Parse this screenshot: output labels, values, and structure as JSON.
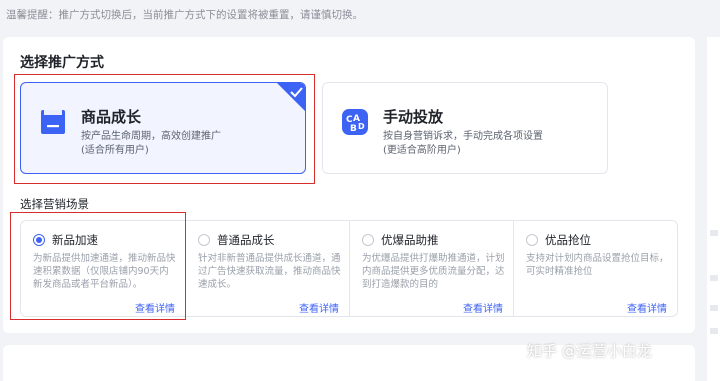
{
  "tip": "温馨提醒：推广方式切换后，当前推广方式下的设置将被重置，请谨慎切换。",
  "promo_section": {
    "title": "选择推广方式",
    "modes": [
      {
        "name": "商品成长",
        "desc_line1": "按产品生命周期，高效创建推广",
        "desc_line2": "(适合所有用户)",
        "selected": true,
        "icon": "product-bag-icon"
      },
      {
        "name": "手动投放",
        "desc_line1": "按自身营销诉求，手动完成各项设置",
        "desc_line2": "(更适合高阶用户)",
        "selected": false,
        "icon": "manual-cards-icon"
      }
    ]
  },
  "scene_section": {
    "title": "选择营销场景",
    "detail_label": "查看详情",
    "scenes": [
      {
        "name": "新品加速",
        "desc": "为新品提供加速通道，推动新品快速积累数据（仅限店铺内90天内新发商品或者平台新品）。",
        "checked": true
      },
      {
        "name": "普通品成长",
        "desc": "针对非新普通品提供成长通道，通过广告快速获取流量，推动商品快速成长。",
        "checked": false
      },
      {
        "name": "优爆品助推",
        "desc": "为优爆品提供打爆助推通道，计划内商品提供更多优质流量分配，达到打造爆款的目的",
        "checked": false
      },
      {
        "name": "优品抢位",
        "desc": "支持对计划内商品设置抢位目标，可实时精准抢位",
        "checked": false
      }
    ]
  },
  "watermark": "知乎 @运营小白龙",
  "colors": {
    "accent": "#3d63f4",
    "annotation_red": "#d62d2d",
    "selected_bg": "#f2f5ff"
  }
}
